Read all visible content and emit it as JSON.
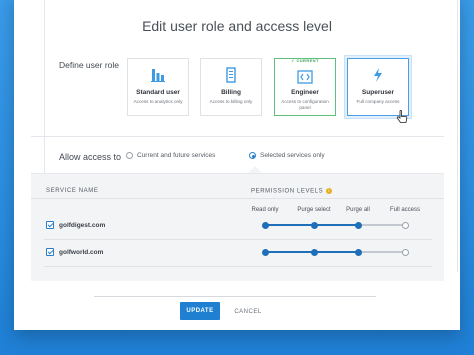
{
  "dialog": {
    "title": "Edit user role and access level",
    "define_role_label": "Define user role",
    "roles": [
      {
        "name": "Standard user",
        "desc": "Access to analytics only",
        "icon": "bar-chart-icon",
        "current": false,
        "selected": false
      },
      {
        "name": "Billing",
        "desc": "Access to billing only",
        "icon": "invoice-icon",
        "current": false,
        "selected": false
      },
      {
        "name": "Engineer",
        "desc": "Access to configuration panel",
        "icon": "code-icon",
        "current": true,
        "selected": false,
        "current_tag": "✓ CURRENT"
      },
      {
        "name": "Superuser",
        "desc": "Full company access",
        "icon": "lightning-icon",
        "current": false,
        "selected": true
      }
    ],
    "access": {
      "label": "Allow access to",
      "options": [
        {
          "label": "Current and future services",
          "checked": false
        },
        {
          "label": "Selected services only",
          "checked": true
        }
      ]
    },
    "table": {
      "col_service": "SERVICE NAME",
      "col_levels": "PERMISSION LEVELS",
      "info_glyph": "i",
      "levels": [
        "Read only",
        "Purge select",
        "Purge all",
        "Full access"
      ],
      "rows": [
        {
          "service": "golfdigest.com",
          "checked": true,
          "level_index": 2
        },
        {
          "service": "golfworld.com",
          "checked": true,
          "level_index": 2
        }
      ]
    },
    "actions": {
      "update": "UPDATE",
      "cancel": "CANCEL"
    }
  },
  "colors": {
    "accent": "#1f7fd1",
    "current_green": "#5fbf7d",
    "background_blue": "#2b8fe0"
  }
}
